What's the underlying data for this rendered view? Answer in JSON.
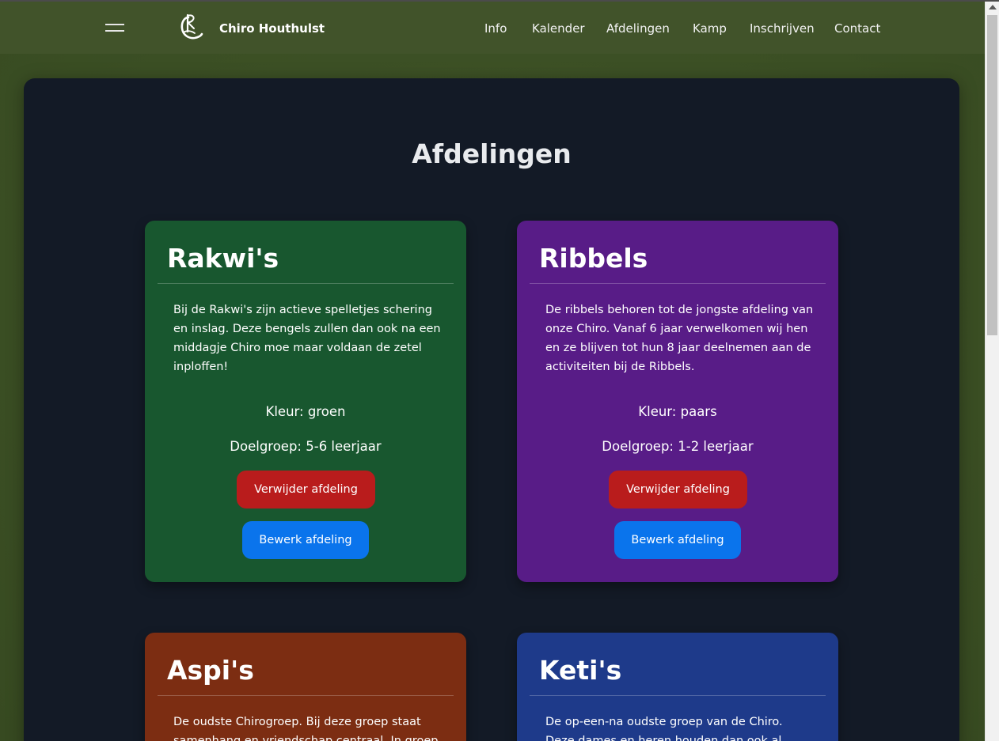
{
  "navbar": {
    "brand": "Chiro Houthulst",
    "links": [
      "Info",
      "Kalender",
      "Afdelingen",
      "Kamp",
      "Inschrijven",
      "Contact"
    ]
  },
  "page": {
    "title": "Afdelingen"
  },
  "cards": [
    {
      "name": "Rakwi's",
      "description": "Bij de Rakwi's zijn actieve spelletjes schering en inslag. Deze bengels zullen dan ook na een middagje Chiro moe maar voldaan de zetel inploffen!",
      "kleur": "Kleur: groen",
      "doelgroep": "Doelgroep: 5-6 leerjaar",
      "delete_label": "Verwijder afdeling",
      "edit_label": "Bewerk afdeling",
      "color": "#18572f"
    },
    {
      "name": "Ribbels",
      "description": "De ribbels behoren tot de jongste afdeling van onze Chiro. Vanaf 6 jaar verwelkomen wij hen en ze blijven tot hun 8 jaar deelnemen aan de activiteiten bij de Ribbels.",
      "kleur": "Kleur: paars",
      "doelgroep": "Doelgroep: 1-2 leerjaar",
      "delete_label": "Verwijder afdeling",
      "edit_label": "Bewerk afdeling",
      "color": "#581c87"
    },
    {
      "name": "Aspi's",
      "description": "De oudste Chirogroep. Bij deze groep staat samenhang en vriendschap centraal. In groep",
      "color": "#7c2d12"
    },
    {
      "name": "Keti's",
      "description": "De op-een-na oudste groep van de Chiro. Deze dames en heren houden dan ook al meer",
      "color": "#1e3a8a"
    }
  ],
  "colors": {
    "navbar_bg": "#41532a",
    "panel_bg": "#131a26",
    "delete_button": "#b91c1c",
    "edit_button": "#0a74ec"
  },
  "icons": {
    "menu": "hamburger-menu-icon",
    "logo": "chiro-logo"
  }
}
